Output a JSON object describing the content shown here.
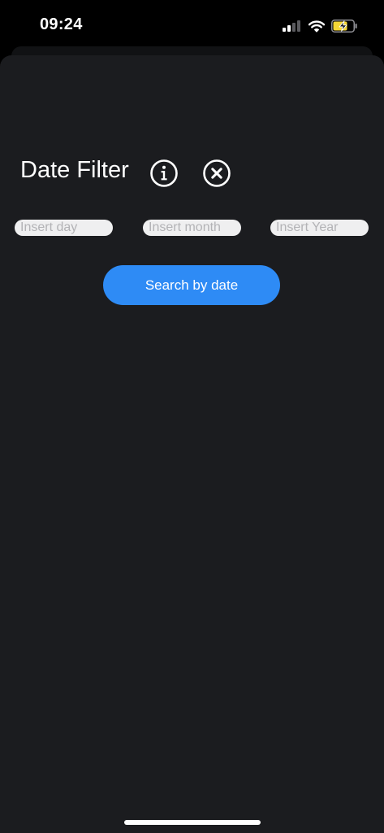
{
  "status_bar": {
    "time": "09:24",
    "icons": [
      "cellular-signal-icon",
      "wifi-icon",
      "battery-charging-icon"
    ]
  },
  "filter": {
    "title": "Date Filter",
    "info_icon": "info-icon",
    "close_icon": "close-circle-icon",
    "day_placeholder": "Insert day",
    "month_placeholder": "Insert month",
    "year_placeholder": "Insert Year",
    "search_label": "Search by date"
  },
  "colors": {
    "background": "#000000",
    "sheet": "#1b1c1f",
    "accent": "#2e8bf5",
    "input_fill": "#efeff0",
    "battery_charge": "#f4d535"
  }
}
